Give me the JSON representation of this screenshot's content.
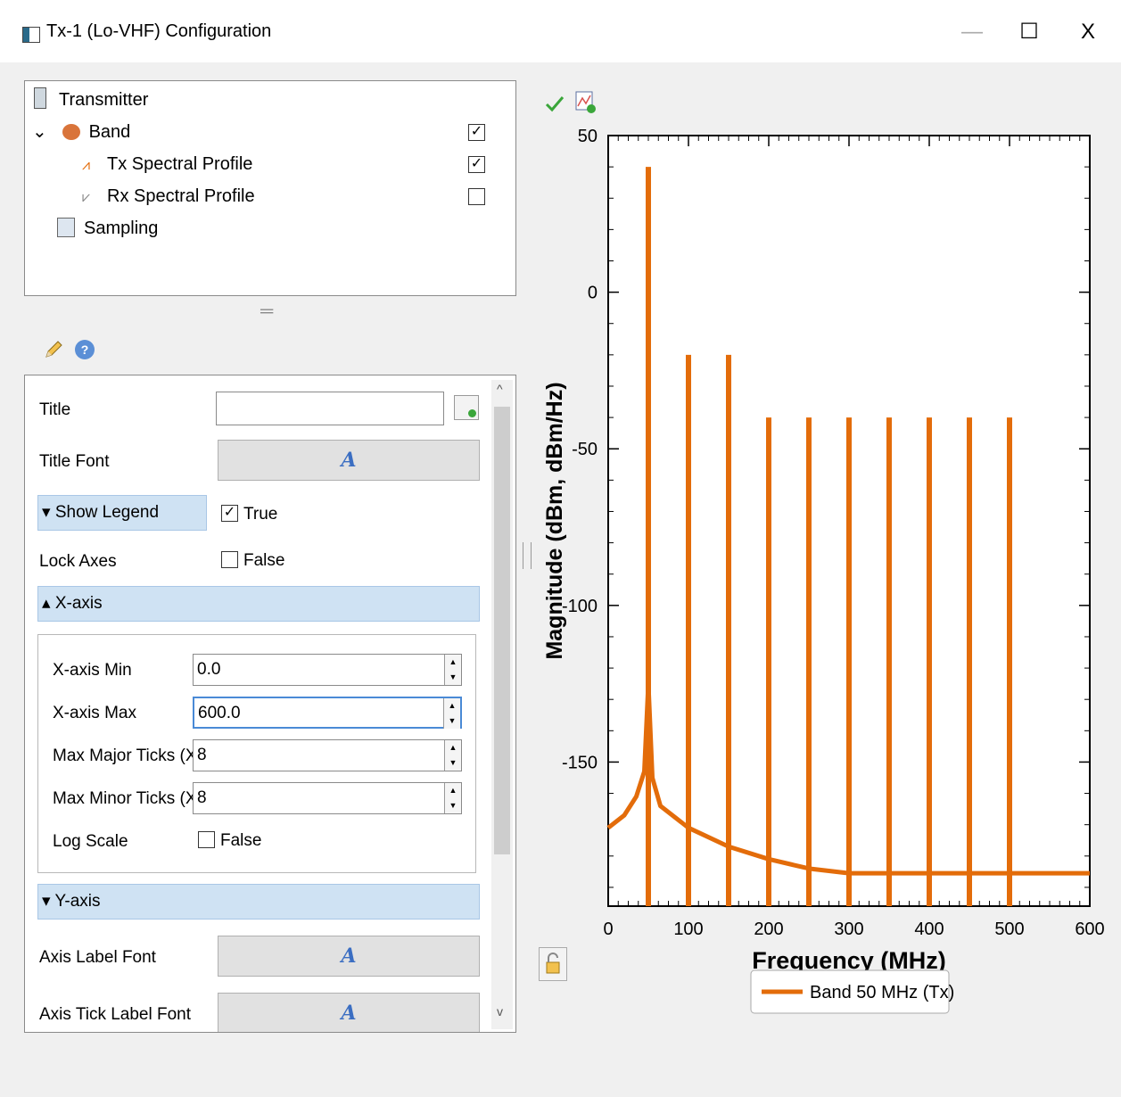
{
  "window": {
    "title": "Tx-1 (Lo-VHF) Configuration",
    "minimize_label": "—",
    "maximize_label": "☐",
    "close_label": "X"
  },
  "tree": {
    "items": [
      {
        "label": "Transmitter"
      },
      {
        "label": "Band",
        "expander": "⌄",
        "checked": true
      },
      {
        "label": "Tx Spectral Profile",
        "checked": true
      },
      {
        "label": "Rx Spectral Profile",
        "checked": false
      },
      {
        "label": "Sampling"
      }
    ]
  },
  "splitter_glyph": "═",
  "props": {
    "title_label": "Title",
    "title_value": "",
    "title_font_label": "Title Font",
    "font_glyph": "A",
    "show_legend_label": "Show Legend",
    "show_legend_value": "True",
    "lock_axes_label": "Lock Axes",
    "lock_axes_value": "False",
    "xaxis_section": "X-axis",
    "xaxis_min_label": "X-axis Min",
    "xaxis_min_value": "0.0",
    "xaxis_max_label": "X-axis Max",
    "xaxis_max_value": "600.0",
    "max_major_ticks_label": "Max Major Ticks (X)",
    "max_major_ticks_value": "8",
    "max_minor_ticks_label": "Max Minor Ticks (X)",
    "max_minor_ticks_value": "8",
    "log_scale_label": "Log Scale",
    "log_scale_value": "False",
    "yaxis_section": "Y-axis",
    "axis_label_font_label": "Axis Label Font",
    "axis_tick_label_font_label": "Axis Tick Label Font",
    "scroll_up": "^",
    "scroll_down": "v"
  },
  "colors": {
    "series": "#e36c0a",
    "section_bg": "#cfe2f3",
    "check_green": "#3aa63a"
  },
  "chart_data": {
    "type": "line",
    "xlabel": "Frequency (MHz)",
    "ylabel": "Magnitude (dBm, dBm/Hz)",
    "xlim": [
      0,
      600
    ],
    "ylim": [
      -196,
      50
    ],
    "xticks": [
      0,
      100,
      200,
      300,
      400,
      500,
      600
    ],
    "yticks": [
      50,
      0,
      -50,
      -100,
      -150
    ],
    "legend": {
      "placement": "bottom",
      "entries": [
        "Band 50 MHz (Tx)"
      ]
    },
    "series": [
      {
        "name": "Band 50 MHz (Tx)",
        "color": "#e36c0a",
        "spikes": [
          {
            "x": 50,
            "y": 40
          },
          {
            "x": 100,
            "y": -20
          },
          {
            "x": 150,
            "y": -20
          },
          {
            "x": 200,
            "y": -40
          },
          {
            "x": 250,
            "y": -40
          },
          {
            "x": 300,
            "y": -40
          },
          {
            "x": 350,
            "y": -40
          },
          {
            "x": 400,
            "y": -40
          },
          {
            "x": 450,
            "y": -40
          },
          {
            "x": 500,
            "y": -40
          }
        ],
        "noise_floor": [
          [
            0,
            -171
          ],
          [
            20,
            -167
          ],
          [
            35,
            -161
          ],
          [
            45,
            -153
          ],
          [
            50,
            -125
          ],
          [
            55,
            -155
          ],
          [
            65,
            -164
          ],
          [
            100,
            -171
          ],
          [
            150,
            -177
          ],
          [
            200,
            -181
          ],
          [
            250,
            -184
          ],
          [
            300,
            -185.5
          ],
          [
            350,
            -185.5
          ],
          [
            400,
            -185.5
          ],
          [
            500,
            -185.5
          ],
          [
            600,
            -185.5
          ]
        ]
      }
    ]
  }
}
